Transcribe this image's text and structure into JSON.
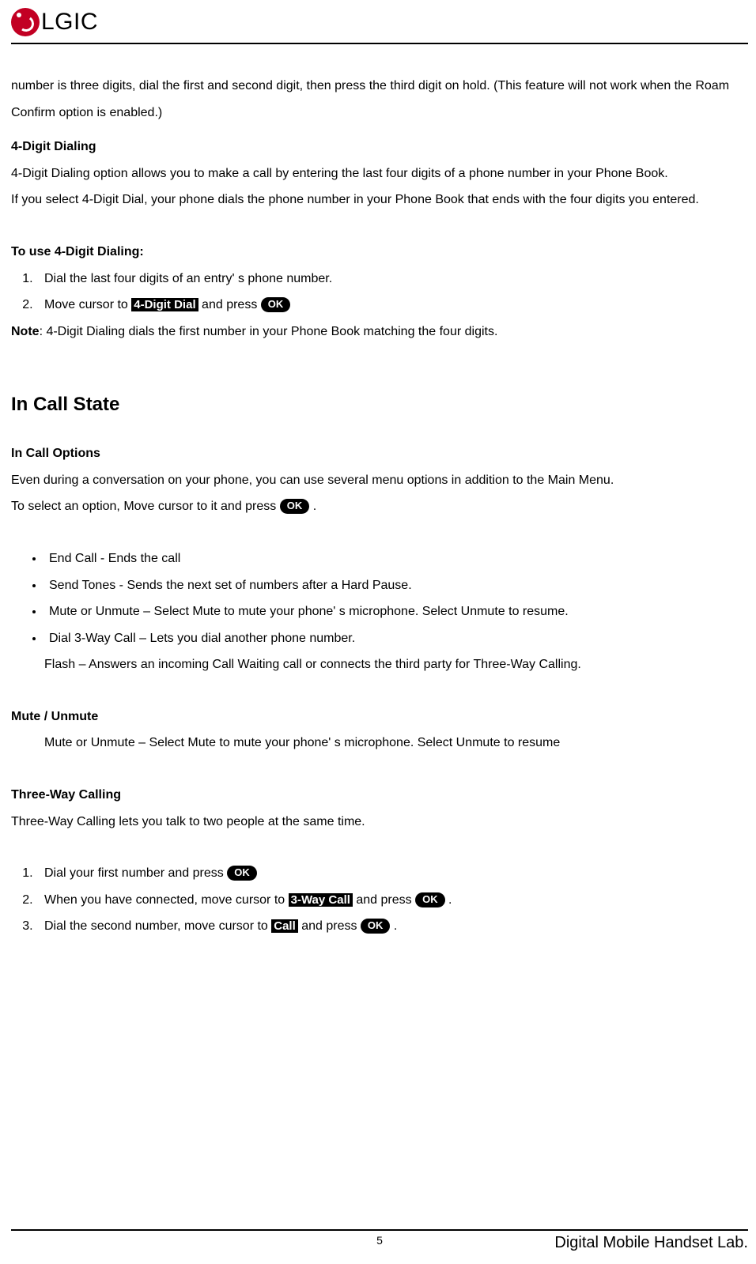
{
  "header": {
    "logo_text": "LGIC"
  },
  "intro_p1": "number is three digits, dial the first and second digit, then press the third digit on hold. (This feature will not work when the Roam Confirm option is enabled.)",
  "sec1": {
    "h1": "4-Digit Dialing",
    "p1": "4-Digit Dialing option allows you to make a call by entering the last four digits of a phone number in your Phone Book.",
    "p2": "If you select 4-Digit Dial, your phone dials the phone number in your Phone Book that ends with the four digits you entered.",
    "h2": "To use 4-Digit Dialing:",
    "step1": "Dial the last four digits of an entry' s phone number.",
    "step2_a": "Move cursor to ",
    "step2_pill": "4-Digit Dial",
    "step2_b": " and press ",
    "note_label": "Note",
    "note_text": ": 4-Digit Dialing dials the first number in your Phone Book matching the four digits."
  },
  "sec2": {
    "title": "In Call State",
    "h1": "In Call Options",
    "p1": "Even during a conversation on your phone, you can use several menu options in addition to the Main Menu.",
    "p2_a": "To select an option, Move cursor to it and press ",
    "p2_c": ".",
    "bullets": [
      "End Call - Ends the call",
      "Send Tones - Sends the next set of numbers after a Hard Pause.",
      "Mute or Unmute – Select Mute to mute your phone' s microphone. Select Unmute to resume.",
      "Dial 3-Way Call – Lets you dial another phone number."
    ],
    "flash_line": "Flash – Answers an incoming Call Waiting call or connects the third party for Three-Way Calling."
  },
  "sec3": {
    "h1": "Mute / Unmute",
    "p1": "Mute or Unmute – Select Mute to mute your phone' s microphone. Select Unmute to resume"
  },
  "sec4": {
    "h1": "Three-Way Calling",
    "p1": "Three-Way Calling lets you talk to two people at the same time.",
    "step1_a": "Dial your first number and press ",
    "step2_a": "When you have connected, move cursor to ",
    "step2_pill": "3-Way Call",
    "step2_b": " and press ",
    "step2_c": " .",
    "step3_a": "Dial the second number, move cursor to ",
    "step3_pill": "Call",
    "step3_b": " and press ",
    "step3_c": " ."
  },
  "ok_label": "OK",
  "footer": {
    "page_num": "5",
    "right": "Digital Mobile Handset Lab."
  }
}
